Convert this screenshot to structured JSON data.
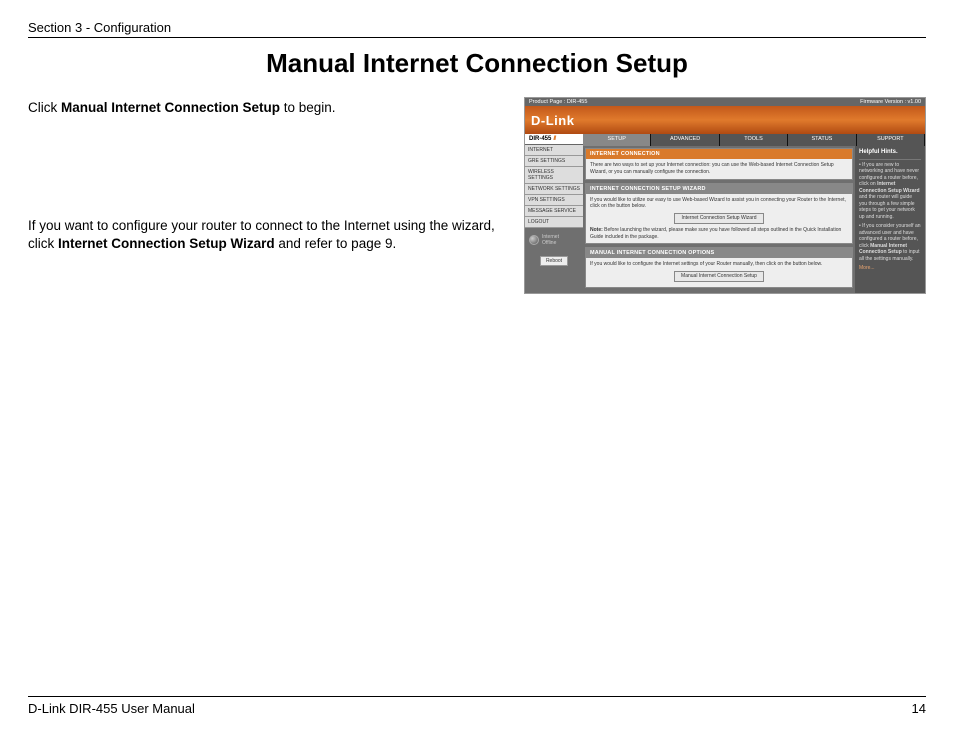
{
  "header": {
    "section": "Section 3 - Configuration"
  },
  "title": "Manual Internet Connection Setup",
  "left": {
    "para1_pre": "Click ",
    "para1_bold": "Manual Internet Connection Setup",
    "para1_post": " to begin.",
    "para2_pre": "If you want to configure your router to connect to the Internet using the wizard, click ",
    "para2_bold": "Internet Connection Setup Wizard",
    "para2_post": " and refer to page 9."
  },
  "router": {
    "topbar": {
      "product": "Product Page :  DIR-455",
      "firmware": "Firmware Version : v1.00"
    },
    "brand": "D-Link",
    "model": "DIR-455",
    "tabs": [
      "SETUP",
      "ADVANCED",
      "TOOLS",
      "STATUS",
      "SUPPORT"
    ],
    "sidebar": [
      "INTERNET",
      "GRE SETTINGS",
      "WIRELESS SETTINGS",
      "NETWORK SETTINGS",
      "VPN SETTINGS",
      "MESSAGE SERVICE",
      "LOGOUT"
    ],
    "globe": {
      "line1": "Internet",
      "line2": "Offline"
    },
    "reboot": "Reboot",
    "panels": {
      "conn": {
        "head": "INTERNET CONNECTION",
        "body": "There are two ways to set up your Internet connection: you can use the Web-based Internet Connection Setup Wizard, or you can manually configure the connection."
      },
      "wizard": {
        "head": "INTERNET CONNECTION SETUP WIZARD",
        "body": "If you would like to utilize our easy to use Web-based Wizard to assist you in connecting your Router to the Internet, click on the button below.",
        "btn": "Internet Connection Setup Wizard",
        "note_label": "Note:",
        "note": " Before launching the wizard, please make sure you have followed all steps outlined in the Quick Installation Guide included in the package."
      },
      "manual": {
        "head": "MANUAL INTERNET CONNECTION OPTIONS",
        "body": "If you would like to configure the Internet settings of your Router manually, then click on the button below.",
        "btn": "Manual Internet Connection Setup"
      }
    },
    "hints": {
      "head": "Helpful Hints.",
      "bullet1_pre": "• If you are new to networking and have never configured a router before, click on ",
      "bullet1_bold": "Internet Connection Setup Wizard",
      "bullet1_post": " and the router will guide you through a few simple steps to get your network up and running.",
      "bullet2_pre": "• If you consider yourself an advanced user and have configured a router before, click ",
      "bullet2_bold": "Manual Internet Connection Setup",
      "bullet2_post": " to input all the settings manually.",
      "more": "More..."
    }
  },
  "footer": {
    "left": "D-Link DIR-455 User Manual",
    "page": "14"
  }
}
